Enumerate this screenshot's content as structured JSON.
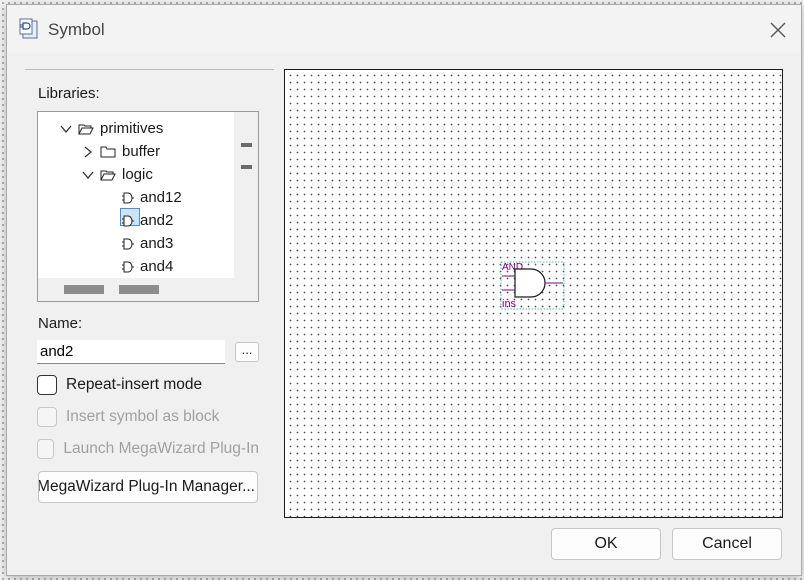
{
  "window": {
    "title": "Symbol"
  },
  "libraries": {
    "label": "Libraries:",
    "tree": [
      {
        "label": "primitives",
        "expanded": true,
        "type": "folder",
        "level": 0
      },
      {
        "label": "buffer",
        "expanded": false,
        "type": "folder",
        "level": 1
      },
      {
        "label": "logic",
        "expanded": true,
        "type": "folder",
        "level": 1
      },
      {
        "label": "and12",
        "type": "symbol",
        "level": 2
      },
      {
        "label": "and2",
        "type": "symbol",
        "level": 2,
        "selected": true
      },
      {
        "label": "and3",
        "type": "symbol",
        "level": 2
      },
      {
        "label": "and4",
        "type": "symbol",
        "level": 2
      }
    ]
  },
  "name": {
    "label": "Name:",
    "value": "and2",
    "browse_label": "..."
  },
  "options": {
    "repeat_insert": {
      "label": "Repeat-insert mode",
      "checked": false,
      "enabled": true
    },
    "insert_as_block": {
      "label": "Insert symbol as block",
      "checked": false,
      "enabled": false
    },
    "launch_megawizard": {
      "label": "Launch MegaWizard Plug-In",
      "checked": false,
      "enabled": false
    }
  },
  "megawizard_button": {
    "label": "MegaWizard Plug-In Manager..."
  },
  "preview": {
    "symbol_name": "AND",
    "instance_name": "ins",
    "symbol_color": "#800080"
  },
  "buttons": {
    "ok": "OK",
    "cancel": "Cancel"
  }
}
